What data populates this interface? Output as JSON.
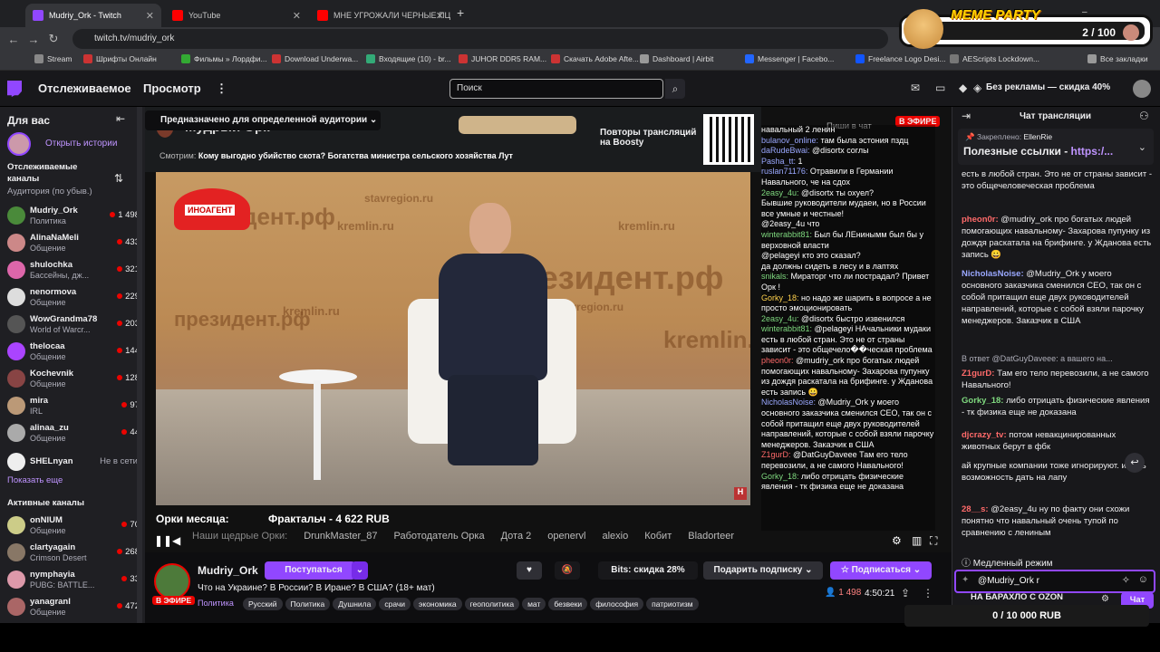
{
  "browser": {
    "tabs": [
      {
        "title": "Mudriy_Ork - Twitch",
        "active": true,
        "favicon": "#9147ff"
      },
      {
        "title": "YouTube",
        "active": false,
        "favicon": "#ff0000"
      },
      {
        "title": "МНЕ УГРОЖАЛИ ЧЕРНЫЕ ПЦ",
        "active": false,
        "favicon": "#ff0000"
      }
    ],
    "url": "twitch.tv/mudriy_ork",
    "bookmarks": [
      "Stream",
      "Шрифты Онлайн",
      "Фильмы » Лордфи...",
      "Download Underwa...",
      "Входящие (10) - br...",
      "JUHOR DDR5 RAM...",
      "Скачать Adobe Afte...",
      "Dashboard | Airbit",
      "Messenger | Facebo...",
      "Freelance Logo Desi...",
      "AEScripts Lockdown...",
      "Все закладки"
    ]
  },
  "overlay": {
    "title": "MEME PARTY",
    "count": "2 / 100"
  },
  "topnav": {
    "following": "Отслеживаемое",
    "browse": "Просмотр",
    "search_placeholder": "Поиск",
    "adfree": "Без рекламы — скидка 40%"
  },
  "sidebar": {
    "for_you": "Для вас",
    "open_stories": "Открыть истории",
    "followed_title": "Отслеживаемые каналы",
    "sort": "Аудитория (по убыв.)",
    "channels": [
      {
        "name": "Mudriy_Ork",
        "cat": "Политика",
        "viewers": "1 498",
        "color": "#4a8a3a"
      },
      {
        "name": "AlinaNaMeli",
        "cat": "Общение",
        "viewers": "433",
        "color": "#c88"
      },
      {
        "name": "shulochka",
        "cat": "Бассейны, дж...",
        "viewers": "321",
        "color": "#d6a"
      },
      {
        "name": "nenormova",
        "cat": "Общение",
        "viewers": "229",
        "color": "#ddd"
      },
      {
        "name": "WowGrandma78",
        "cat": "World of Warcr...",
        "viewers": "203",
        "color": "#555"
      },
      {
        "name": "thelocaa",
        "cat": "Общение",
        "viewers": "144",
        "color": "#a4f"
      },
      {
        "name": "Kochevnik",
        "cat": "Общение",
        "viewers": "128",
        "color": "#844"
      },
      {
        "name": "mira",
        "cat": "IRL",
        "viewers": "97",
        "color": "#b97"
      },
      {
        "name": "alinaa_zu",
        "cat": "Общение",
        "viewers": "44",
        "color": "#aaa"
      }
    ],
    "offline": {
      "name": "SHELnyan",
      "status": "Не в сети"
    },
    "show_more": "Показать еще",
    "active_title": "Активные каналы",
    "active": [
      {
        "name": "onNIUM",
        "cat": "Общение",
        "viewers": "70",
        "color": "#cc8"
      },
      {
        "name": "clartyagain",
        "cat": "Crimson Desert",
        "viewers": "268",
        "color": "#876"
      },
      {
        "name": "nymphayia",
        "cat": "PUBG: BATTLE...",
        "viewers": "33",
        "color": "#d9a"
      },
      {
        "name": "yanagranl",
        "cat": "Общение",
        "viewers": "472",
        "color": "#a66"
      }
    ]
  },
  "player": {
    "audience": "Предназначено для определенной аудитории",
    "streamer_title": "Мудрый Орк",
    "watching_label": "Смотрим:",
    "watching": "Кому выгодно убийство скота? Богатства министра сельского хозяйства Лут",
    "boosty": "Повторы трансляций на Boosty",
    "chat_hint": "Пиши в чат",
    "live": "В ЭФИРЕ",
    "hat": "ИНОАГЕНТ",
    "wm1": "президент.рф",
    "wm2": "kremlin.ru",
    "wm3": "stavregion.ru",
    "orks_label": "Орки месяца:",
    "orks_value": "Фрактальч - 4 622 RUB",
    "generous": [
      "Наши щедрые Орки:",
      "DrunkMaster_87",
      "Работодатель Орка",
      "Дота 2",
      "openervl",
      "alexio",
      "Кобит",
      "Bladorteer"
    ]
  },
  "overlay_chat": [
    {
      "u": "",
      "t": "навальный 2 ленин",
      "c": "u1"
    },
    {
      "u": "bulanov_online:",
      "t": "там была эстония пздц",
      "c": "u3"
    },
    {
      "u": "daRudeBwai:",
      "t": "@disortx соглы",
      "c": "u3"
    },
    {
      "u": "Pasha_tt:",
      "t": "1",
      "c": "u3"
    },
    {
      "u": "ruslan71176:",
      "t": "Отравили в Германии Навального, че на сдох",
      "c": "u3"
    },
    {
      "u": "2easy_4u:",
      "t": "@disortx ты охуел?",
      "c": "u2"
    },
    {
      "u": "",
      "t": "Бывшие руководители мудаеи, но в России все умные и честные!",
      "c": "u1"
    },
    {
      "u": "",
      "t": "@2easy_4u что",
      "c": "u1"
    },
    {
      "u": "winterabbit81:",
      "t": "Был бы ЛЕнинымм был бы у верховной власти",
      "c": "u2"
    },
    {
      "u": "",
      "t": "@pelageyi кто это сказал?",
      "c": "u1"
    },
    {
      "u": "",
      "t": "да должны сидеть в лесу и в лаптях",
      "c": "u1"
    },
    {
      "u": "snikals:",
      "t": "Мираторг что ли пострадал? Привет Орк !",
      "c": "u2"
    },
    {
      "u": "Gorky_18:",
      "t": "но надо же шарить в вопросе а не просто эмоционировать",
      "c": "u4"
    },
    {
      "u": "2easy_4u:",
      "t": "@disortx быстро извенился",
      "c": "u2"
    },
    {
      "u": "winterabbit81:",
      "t": "@pelageyi НАчальники мудаки есть в любой стран. Это не от страны зависит - это общечело��ческая проблема",
      "c": "u2"
    },
    {
      "u": "pheon0r:",
      "t": "@mudriy_ork про богатых людей помогающих навальному- Захарова пупунку из дождя раскатала на брифинге. у Жданова есть запись 😀",
      "c": "u1"
    },
    {
      "u": "NicholasNoise:",
      "t": "@Mudriy_Ork у моего основного заказчика сменился CEO, так он с собой притащил еще двух руководителей направлений, которые с собой взяли парочку менеджеров. Заказчик в США",
      "c": "u3"
    },
    {
      "u": "Z1gurD:",
      "t": "@DatGuyDaveee Там его тело перевозили, а не самого Навального!",
      "c": "u1"
    },
    {
      "u": "Gorky_18:",
      "t": "либо отрицать физические явления - тк физика еще не доказана",
      "c": "u2"
    }
  ],
  "info": {
    "channel": "Mudriy_Ork",
    "title": "Что на Украине? В России? В Иране? В США? (18+ мат)",
    "live": "В ЭФИРЕ",
    "category": "Политика",
    "tags": [
      "Русский",
      "Политика",
      "Душнила",
      "срачи",
      "экономика",
      "геополитика",
      "мат",
      "безвеки",
      "философия",
      "патриотизм"
    ],
    "join": "Поступаться",
    "bits": "Bits: скидка 28%",
    "gift": "Подарить подписку",
    "subscribe": "Подписаться",
    "viewers": "1 498",
    "uptime": "4:50:21"
  },
  "chat": {
    "title": "Чат трансляции",
    "pinned_label": "Закреплено:",
    "pinned_user": "EllenRie",
    "pinned_text": "Полезные ссылки -",
    "pinned_link": "https:/...",
    "messages": [
      {
        "u": "",
        "t": "есть в любой стран. Это не от страны зависит - это общечеловеческая проблема",
        "c": "u1"
      },
      {
        "u": "pheon0r:",
        "t": "@mudriy_ork про богатых людей помогающих навальному- Захарова пупунку из дождя раскатала на брифинге. у Жданова есть запись 😀",
        "c": "u1"
      },
      {
        "u": "NicholasNoise:",
        "t": "@Mudriy_Ork у моего основного заказчика сменился CEO, так он с собой притащил еще двух руководителей направлений, которые с собой взяли парочку менеджеров. Заказчик в США",
        "c": "u3"
      },
      {
        "u": "",
        "t": "В ответ @DatGuyDaveee: а вашего на...",
        "c": ""
      },
      {
        "u": "Z1gurD:",
        "t": "Там его тело перевозили, а не самого Навального!",
        "c": "u1"
      },
      {
        "u": "Gorky_18:",
        "t": "либо отрицать физические явления - тк физика еще не доказана",
        "c": "u2"
      },
      {
        "u": "djcrazy_tv:",
        "t": "потом невакцинированных животных берут в фбк",
        "c": "u1"
      },
      {
        "u": "",
        "t": "ай крупные компании тоже игнорируют. и есть возможность дать на лапу",
        "c": "u1"
      },
      {
        "u": "28__s:",
        "t": "@2easy_4u ну по факту они схожи понятно что навальный очень тупой по сравнению с лениным",
        "c": "u1"
      }
    ],
    "slow_mode": "Медленный режим",
    "input_value": "@Mudriy_Ork r",
    "promo": "НА БАРАХЛО С OZON",
    "send": "Чат"
  },
  "donate": "0 / 10 000 RUB"
}
